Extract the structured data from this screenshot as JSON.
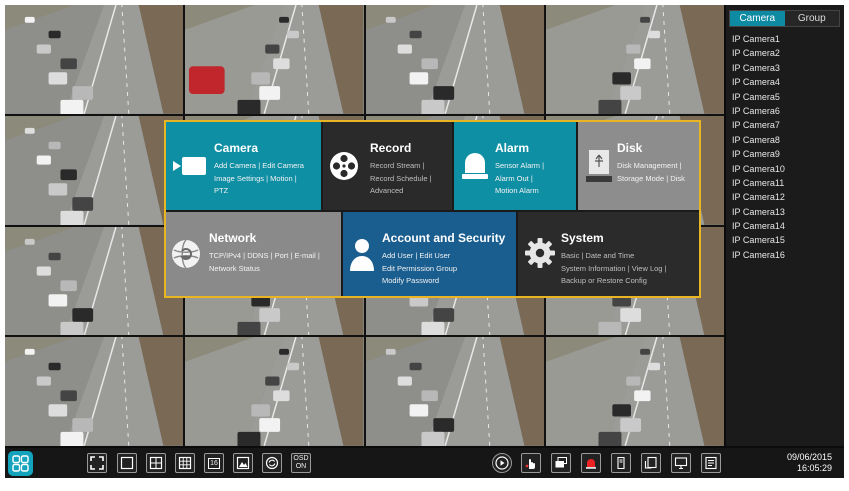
{
  "side_panel": {
    "tabs": [
      {
        "label": "Camera",
        "active": true
      },
      {
        "label": "Group",
        "active": false
      }
    ],
    "cameras": [
      "IP Camera1",
      "IP Camera2",
      "IP Camera3",
      "IP Camera4",
      "IP Camera5",
      "IP Camera6",
      "IP Camera7",
      "IP Camera8",
      "IP Camera9",
      "IP Camera10",
      "IP Camera11",
      "IP Camera12",
      "IP Camera13",
      "IP Camera14",
      "IP Camera15",
      "IP Camera16"
    ]
  },
  "menu": {
    "camera": {
      "title": "Camera",
      "items": [
        "Add Camera",
        "Edit Camera",
        "Image Settings",
        "Motion",
        "PTZ"
      ],
      "icon": "camcorder-icon"
    },
    "record": {
      "title": "Record",
      "items": [
        "Record Stream",
        "Record Schedule",
        "Advanced"
      ],
      "icon": "film-reel-icon"
    },
    "alarm": {
      "title": "Alarm",
      "items": [
        "Sensor Alarm",
        "Alarm Out",
        "Motion Alarm"
      ],
      "icon": "siren-icon"
    },
    "disk": {
      "title": "Disk",
      "items": [
        "Disk Management",
        "Storage Mode",
        "Disk"
      ],
      "icon": "hard-disk-icon"
    },
    "network": {
      "title": "Network",
      "items": [
        "TCP/IPv4",
        "DDNS",
        "Port",
        "E-mail",
        "Network Status"
      ],
      "icon": "globe-icon"
    },
    "account": {
      "title": "Account and Security",
      "items": [
        "Add User",
        "Edit User",
        "Edit Permission Group",
        "Modify Password"
      ],
      "icon": "user-icon"
    },
    "system": {
      "title": "System",
      "items": [
        "Basic",
        "Date and Time",
        "System Information",
        "View Log",
        "Backup or Restore Config"
      ],
      "icon": "gear-icon"
    }
  },
  "toolbar": {
    "osd_line1": "OSD",
    "osd_line2": "ON",
    "layout16_label": "16"
  },
  "clock": {
    "date": "09/06/2015",
    "time": "16:05:29"
  },
  "colors": {
    "accent": "#0f8fa4",
    "highlight": "#e7b622",
    "account": "#1a5d8f"
  }
}
